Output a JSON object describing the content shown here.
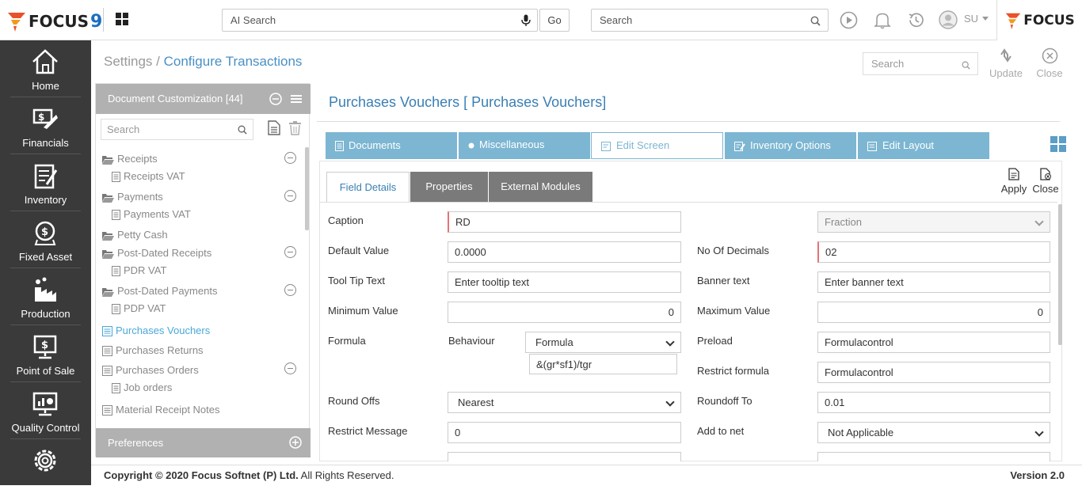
{
  "topbar": {
    "logo_text": "FOCUS",
    "logo_num": "9",
    "ai_search_placeholder": "AI Search",
    "go_label": "Go",
    "search_placeholder": "Search",
    "user_initials": "SU",
    "brand_text": "FOCUS"
  },
  "sidebar": {
    "items": [
      {
        "label": "Home",
        "icon": "home-icon"
      },
      {
        "label": "Financials",
        "icon": "financials-icon"
      },
      {
        "label": "Inventory",
        "icon": "inventory-icon"
      },
      {
        "label": "Fixed Asset",
        "icon": "fixed-asset-icon"
      },
      {
        "label": "Production",
        "icon": "production-icon"
      },
      {
        "label": "Point of Sale",
        "icon": "pos-icon"
      },
      {
        "label": "Quality Control",
        "icon": "quality-control-icon"
      },
      {
        "label": "Settings",
        "icon": "settings-icon"
      }
    ]
  },
  "header": {
    "breadcrumb_root": "Settings",
    "breadcrumb_sep": " / ",
    "breadcrumb_current": "Configure Transactions",
    "search_placeholder": "Search",
    "update_label": "Update",
    "close_label": "Close"
  },
  "leftpanel": {
    "title": "Document Customization [44]",
    "search_placeholder": "Search",
    "tree": [
      {
        "label": "Receipts",
        "type": "folder"
      },
      {
        "label": "Receipts VAT",
        "type": "doc"
      },
      {
        "label": "Payments",
        "type": "folder"
      },
      {
        "label": "Payments VAT",
        "type": "doc"
      },
      {
        "label": "Petty Cash",
        "type": "folder"
      },
      {
        "label": "Post-Dated Receipts",
        "type": "folder"
      },
      {
        "label": "PDR VAT",
        "type": "doc"
      },
      {
        "label": "Post-Dated Payments",
        "type": "folder"
      },
      {
        "label": "PDP VAT",
        "type": "doc"
      },
      {
        "label": "Purchases Vouchers",
        "type": "list"
      },
      {
        "label": "Purchases Returns",
        "type": "list"
      },
      {
        "label": "Purchases Orders",
        "type": "list"
      },
      {
        "label": "Job orders",
        "type": "doc"
      },
      {
        "label": "Material Receipt Notes",
        "type": "list"
      }
    ],
    "footer_label": "Preferences"
  },
  "main": {
    "title": "Purchases Vouchers [ Purchases Vouchers]",
    "tabs": [
      "Documents",
      "Miscellaneous",
      "Edit Screen",
      "Inventory Options",
      "Edit Layout"
    ],
    "subtabs": [
      "Field Details",
      "Properties",
      "External Modules"
    ],
    "apply_label": "Apply",
    "close_label": "Close",
    "fields": {
      "caption_label": "Caption",
      "caption_value": "RD",
      "fraction_value": "Fraction",
      "default_label": "Default Value",
      "default_value": "0.0000",
      "decimals_label": "No Of Decimals",
      "decimals_value": "02",
      "tooltip_label": "Tool Tip Text",
      "tooltip_placeholder": "Enter tooltip text",
      "banner_label": "Banner text",
      "banner_placeholder": "Enter banner text",
      "min_label": "Minimum Value",
      "min_value": "0",
      "max_label": "Maximum Value",
      "max_value": "0",
      "formula_label": "Formula",
      "behaviour_label": "Behaviour",
      "behaviour_value": "Formula",
      "formula_expr": "&(gr*sf1)/tgr",
      "preload_label": "Preload",
      "preload_value": "Formulacontrol",
      "restrict_formula_label": "Restrict formula",
      "restrict_formula_value": "Formulacontrol",
      "roundoffs_label": "Round Offs",
      "roundoffs_value": "Nearest",
      "roundoffto_label": "Roundoff To",
      "roundoffto_value": "0.01",
      "restrict_msg_label": "Restrict Message",
      "restrict_msg_value": "0",
      "addtonet_label": "Add to net",
      "addtonet_value": "Not Applicable"
    }
  },
  "footer": {
    "copyright_bold": "Copyright © 2020 Focus Softnet (P) Ltd.",
    "copyright_rest": " All Rights Reserved.",
    "version": "Version 2.0"
  }
}
